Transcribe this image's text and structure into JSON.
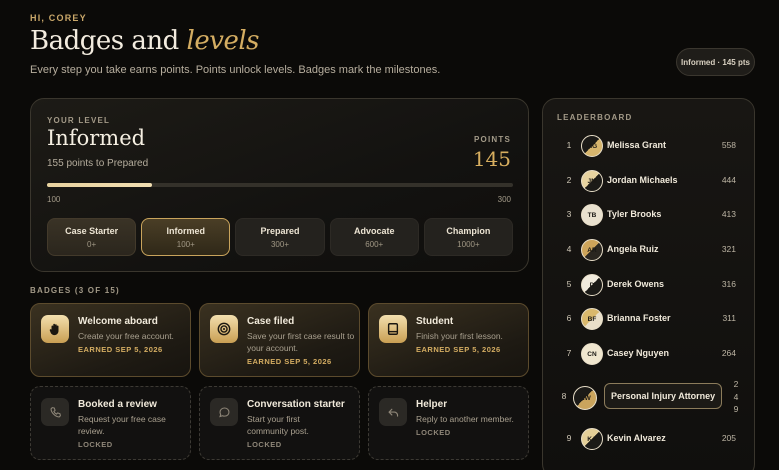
{
  "header": {
    "greeting": "HI, COREY",
    "title_main": "Badges and",
    "title_accent": "levels",
    "subtitle": "Every step you take earns points. Points unlock levels. Badges mark the milestones.",
    "points_pill": "Informed · 145 pts"
  },
  "level": {
    "eyebrow": "YOUR LEVEL",
    "name": "Informed",
    "next_text": "155 points to Prepared",
    "points_label": "POINTS",
    "points_value": "145",
    "progress_min": "100",
    "progress_max": "300",
    "progress_fraction": 0.225,
    "tiers": [
      {
        "name": "Case Starter",
        "points": "0+",
        "state": "done"
      },
      {
        "name": "Informed",
        "points": "100+",
        "state": "current"
      },
      {
        "name": "Prepared",
        "points": "300+",
        "state": "upcoming"
      },
      {
        "name": "Advocate",
        "points": "600+",
        "state": "upcoming"
      },
      {
        "name": "Champion",
        "points": "1000+",
        "state": "upcoming"
      }
    ]
  },
  "badges": {
    "heading": "BADGES (3 OF 15)",
    "items": [
      {
        "title": "Welcome aboard",
        "desc": "Create your free account.",
        "meta": "EARNED SEP 5, 2026",
        "icon": "hand-icon",
        "state": "earned"
      },
      {
        "title": "Case filed",
        "desc": "Save your first case result to your account.",
        "meta": "EARNED SEP 5, 2026",
        "icon": "target-icon",
        "state": "earned"
      },
      {
        "title": "Student",
        "desc": "Finish your first lesson.",
        "meta": "EARNED SEP 5, 2026",
        "icon": "book-icon",
        "state": "earned"
      },
      {
        "title": "Booked a review",
        "desc": "Request your free case review.",
        "meta": "LOCKED",
        "icon": "phone-icon",
        "state": "locked"
      },
      {
        "title": "Conversation starter",
        "desc": "Start your first community post.",
        "meta": "LOCKED",
        "icon": "chat-bubble-icon",
        "state": "locked"
      },
      {
        "title": "Helper",
        "desc": "Reply to another member.",
        "meta": "LOCKED",
        "icon": "reply-icon",
        "state": "locked"
      }
    ]
  },
  "leaderboard": {
    "heading": "LEADERBOARD",
    "rows": [
      {
        "rank": "1",
        "initials": "MG",
        "name": "Melissa Grant",
        "score": "558"
      },
      {
        "rank": "2",
        "initials": "JM",
        "name": "Jordan Michaels",
        "score": "444"
      },
      {
        "rank": "3",
        "initials": "TB",
        "name": "Tyler Brooks",
        "score": "413"
      },
      {
        "rank": "4",
        "initials": "AR",
        "name": "Angela Ruiz",
        "score": "321"
      },
      {
        "rank": "5",
        "initials": "D",
        "name": "Derek Owens",
        "score": "316"
      },
      {
        "rank": "6",
        "initials": "BF",
        "name": "Brianna Foster",
        "score": "311"
      },
      {
        "rank": "7",
        "initials": "CN",
        "name": "Casey Nguyen",
        "score": "264"
      },
      {
        "rank": "8",
        "initials": "MW",
        "name": "Personal Injury Attorney",
        "score": "249",
        "you": true
      },
      {
        "rank": "9",
        "initials": "KA",
        "name": "Kevin Alvarez",
        "score": "205"
      }
    ]
  },
  "colors": {
    "accent": "#d4ad62",
    "background": "#0b0a08",
    "card_border": "#3a362d"
  }
}
